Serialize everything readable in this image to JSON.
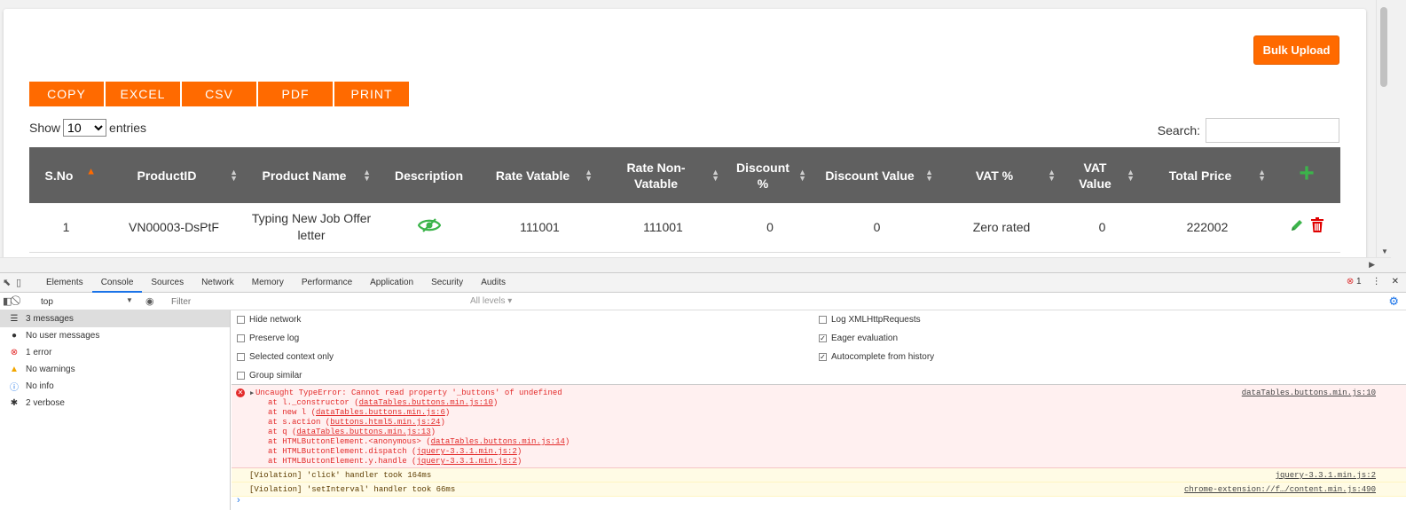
{
  "page": {
    "bulk_upload_label": "Bulk Upload",
    "export_buttons": [
      "COPY",
      "EXCEL",
      "CSV",
      "PDF",
      "PRINT"
    ],
    "length": {
      "show": "Show",
      "value": "10",
      "entries": "entries"
    },
    "search_label": "Search:",
    "table": {
      "headers": [
        "S.No",
        "ProductID",
        "Product Name",
        "Description",
        "Rate Vatable",
        "Rate Non-Vatable",
        "Discount %",
        "Discount Value",
        "VAT %",
        "VAT Value",
        "Total Price"
      ],
      "rows": [
        {
          "sno": "1",
          "product_id": "VN00003-DsPtF",
          "product_name": "Typing New Job Offer letter",
          "rate_vatable": "111001",
          "rate_non_vatable": "111001",
          "discount_pct": "0",
          "discount_value": "0",
          "vat_pct": "Zero rated",
          "vat_value": "0",
          "total_price": "222002"
        }
      ]
    }
  },
  "devtools": {
    "tabs": [
      "Elements",
      "Console",
      "Sources",
      "Network",
      "Memory",
      "Performance",
      "Application",
      "Security",
      "Audits"
    ],
    "active_tab": "Console",
    "error_count": "1",
    "context": "top",
    "filter_placeholder": "Filter",
    "levels": "All levels",
    "sidebar": [
      {
        "icon": "list",
        "label": "3 messages"
      },
      {
        "icon": "user",
        "label": "No user messages"
      },
      {
        "icon": "error",
        "label": "1 error"
      },
      {
        "icon": "warning",
        "label": "No warnings"
      },
      {
        "icon": "info",
        "label": "No info"
      },
      {
        "icon": "bug",
        "label": "2 verbose"
      }
    ],
    "options_left": [
      "Hide network",
      "Preserve log",
      "Selected context only",
      "Group similar"
    ],
    "options_right": [
      "Log XMLHttpRequests",
      "Eager evaluation",
      "Autocomplete from history"
    ],
    "error": {
      "message": "Uncaught TypeError: Cannot read property '_buttons' of undefined",
      "source": "dataTables.buttons.min.js:10",
      "stack": [
        {
          "at": "at l._constructor (",
          "src": "dataTables.buttons.min.js:10",
          "end": ")"
        },
        {
          "at": "at new l (",
          "src": "dataTables.buttons.min.js:6",
          "end": ")"
        },
        {
          "at": "at s.action (",
          "src": "buttons.html5.min.js:24",
          "end": ")"
        },
        {
          "at": "at q (",
          "src": "dataTables.buttons.min.js:13",
          "end": ")"
        },
        {
          "at": "at HTMLButtonElement.<anonymous> (",
          "src": "dataTables.buttons.min.js:14",
          "end": ")"
        },
        {
          "at": "at HTMLButtonElement.dispatch (",
          "src": "jquery-3.3.1.min.js:2",
          "end": ")"
        },
        {
          "at": "at HTMLButtonElement.y.handle (",
          "src": "jquery-3.3.1.min.js:2",
          "end": ")"
        }
      ]
    },
    "violations": [
      {
        "text": "[Violation] 'click' handler took 164ms",
        "source": "jquery-3.3.1.min.js:2"
      },
      {
        "text": "[Violation] 'setInterval' handler took 66ms",
        "source": "chrome-extension://f…/content.min.js:490"
      }
    ],
    "prompt": "›"
  },
  "colors": {
    "accent": "#ff6a00",
    "table_header": "#606060",
    "add": "#3cb44b",
    "delete": "#e00000",
    "devtools_blue": "#1a73e8"
  }
}
